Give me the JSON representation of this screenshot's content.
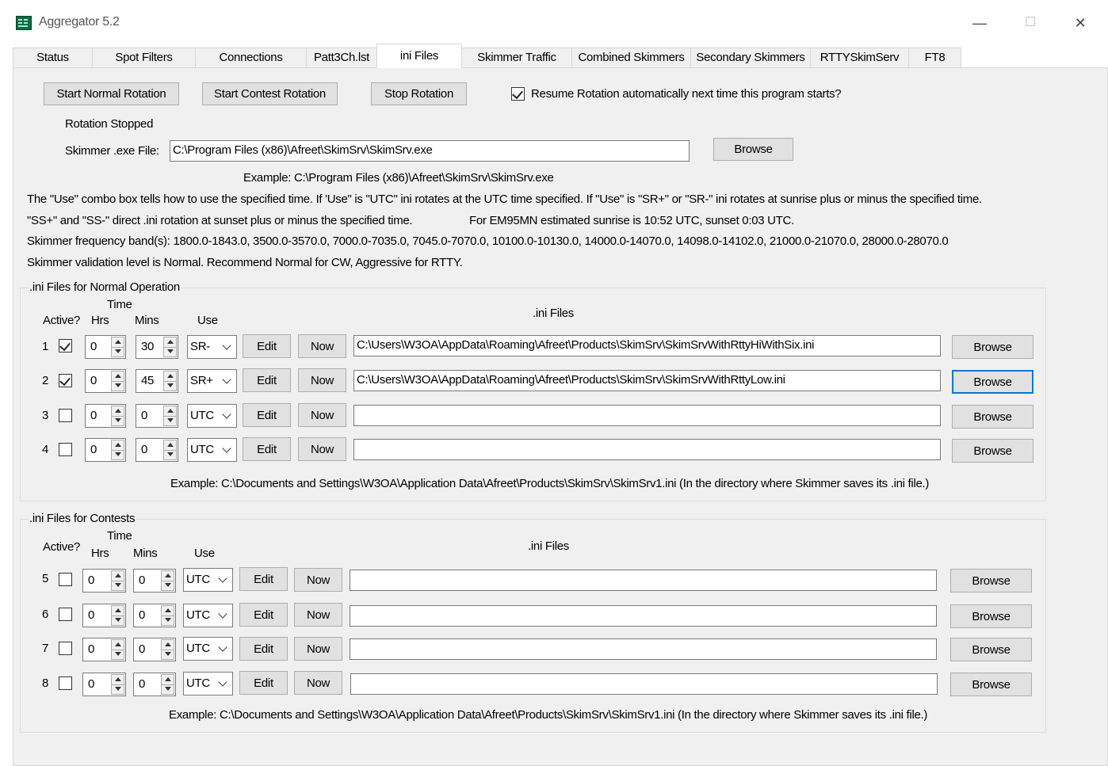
{
  "window": {
    "title": "Aggregator 5.2",
    "minimize": "—",
    "maximize": "☐",
    "close": "✕"
  },
  "tabs": [
    "Status",
    "Spot Filters",
    "Connections",
    "Patt3Ch.lst",
    "ini Files",
    "Skimmer Traffic",
    "Combined Skimmers",
    "Secondary Skimmers",
    "RTTYSkimServ",
    "FT8"
  ],
  "active_tab": "ini Files",
  "rotation": {
    "start_normal": "Start Normal Rotation",
    "start_contest": "Start Contest Rotation",
    "stop": "Stop Rotation",
    "resume_label": "Resume Rotation automatically next time this program starts?",
    "resume_checked": true,
    "status": "Rotation Stopped"
  },
  "skimmer": {
    "exe_label": "Skimmer .exe File:",
    "exe_value": "C:\\Program Files (x86)\\Afreet\\SkimSrv\\SkimSrv.exe",
    "browse": "Browse",
    "example": "Example: C:\\Program Files (x86)\\Afreet\\SkimSrv\\SkimSrv.exe"
  },
  "info": {
    "line1": "The \"Use\" combo box tells how to use the specified time.  If 'Use\" is \"UTC\" ini rotates at the UTC time specified. If \"Use\" is \"SR+\" or \"SR-\" ini rotates at sunrise plus or minus the specified time.",
    "line2a": "\"SS+\" and \"SS-\" direct .ini rotation at sunset plus or minus the specified time.",
    "line2b": "For EM95MN estimated sunrise is 10:52 UTC, sunset 0:03 UTC.",
    "line3": "Skimmer frequency band(s): 1800.0-1843.0, 3500.0-3570.0, 7000.0-7035.0, 7045.0-7070.0, 10100.0-10130.0, 14000.0-14070.0, 14098.0-14102.0, 21000.0-21070.0, 28000.0-28070.0",
    "line4": "Skimmer validation level is Normal. Recommend Normal for CW, Aggressive for RTTY."
  },
  "normal": {
    "group_label": ".ini Files for Normal Operation",
    "headers": {
      "time": "Time",
      "active": "Active?",
      "hrs": "Hrs",
      "mins": "Mins",
      "use": "Use",
      "files": ".ini Files"
    },
    "rows": [
      {
        "num": "1",
        "active": true,
        "hrs": "0",
        "mins": "30",
        "use": "SR-",
        "edit": "Edit",
        "now": "Now",
        "path": "C:\\Users\\W3OA\\AppData\\Roaming\\Afreet\\Products\\SkimSrv\\SkimSrvWithRttyHiWithSix.ini",
        "browse": "Browse"
      },
      {
        "num": "2",
        "active": true,
        "hrs": "0",
        "mins": "45",
        "use": "SR+",
        "edit": "Edit",
        "now": "Now",
        "path": "C:\\Users\\W3OA\\AppData\\Roaming\\Afreet\\Products\\SkimSrv\\SkimSrvWithRttyLow.ini",
        "browse": "Browse"
      },
      {
        "num": "3",
        "active": false,
        "hrs": "0",
        "mins": "0",
        "use": "UTC",
        "edit": "Edit",
        "now": "Now",
        "path": "",
        "browse": "Browse"
      },
      {
        "num": "4",
        "active": false,
        "hrs": "0",
        "mins": "0",
        "use": "UTC",
        "edit": "Edit",
        "now": "Now",
        "path": "",
        "browse": "Browse"
      }
    ],
    "example": "Example: C:\\Documents and Settings\\W3OA\\Application Data\\Afreet\\Products\\SkimSrv\\SkimSrv1.ini  (In the directory where Skimmer saves its .ini file.)"
  },
  "contest": {
    "group_label": ".ini Files for Contests",
    "headers": {
      "time": "Time",
      "active": "Active?",
      "hrs": "Hrs",
      "mins": "Mins",
      "use": "Use",
      "files": ".ini Files"
    },
    "rows": [
      {
        "num": "5",
        "active": false,
        "hrs": "0",
        "mins": "0",
        "use": "UTC",
        "edit": "Edit",
        "now": "Now",
        "path": "",
        "browse": "Browse"
      },
      {
        "num": "6",
        "active": false,
        "hrs": "0",
        "mins": "0",
        "use": "UTC",
        "edit": "Edit",
        "now": "Now",
        "path": "",
        "browse": "Browse"
      },
      {
        "num": "7",
        "active": false,
        "hrs": "0",
        "mins": "0",
        "use": "UTC",
        "edit": "Edit",
        "now": "Now",
        "path": "",
        "browse": "Browse"
      },
      {
        "num": "8",
        "active": false,
        "hrs": "0",
        "mins": "0",
        "use": "UTC",
        "edit": "Edit",
        "now": "Now",
        "path": "",
        "browse": "Browse"
      }
    ],
    "example": "Example: C:\\Documents and Settings\\W3OA\\Application Data\\Afreet\\Products\\SkimSrv\\SkimSrv1.ini  (In the directory where Skimmer saves its .ini file.)"
  },
  "colors": {
    "focus": "#0078d7",
    "panel": "#f0f0f0",
    "button": "#e1e1e1",
    "icon": "#0e6b45"
  }
}
